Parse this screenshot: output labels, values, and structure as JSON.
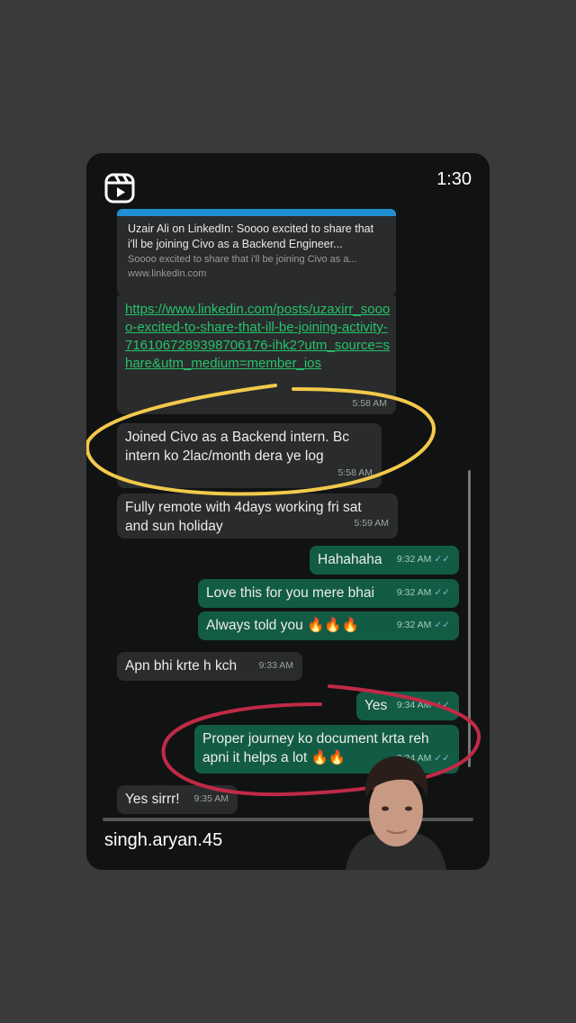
{
  "story": {
    "timer": "1:30",
    "username": "singh.aryan.45"
  },
  "link_preview": {
    "title": "Uzair Ali on LinkedIn: Soooo excited to share that i'll be joining Civo as a Backend Engineer...",
    "description": "Soooo excited to share that i'll be joining Civo as a...",
    "domain": "www.linkedin.com",
    "url": "https://www.linkedin.com/posts/uzaxirr_soooo-excited-to-share-that-ill-be-joining-activity-7161067289398706176-ihk2?utm_source=share&utm_medium=member_ios",
    "time": "5:58 AM"
  },
  "messages": [
    {
      "direction": "in",
      "text": "Joined Civo as a Backend intern. Bc intern ko 2lac/month dera ye log",
      "time": "5:58 AM"
    },
    {
      "direction": "in",
      "text": "Fully remote with 4days working fri sat and sun holiday",
      "time": "5:59 AM"
    },
    {
      "direction": "out",
      "text": "Hahahaha",
      "time": "9:32 AM"
    },
    {
      "direction": "out",
      "text": "Love this for you mere bhai",
      "time": "9:32 AM"
    },
    {
      "direction": "out",
      "text": "Always told you 🔥🔥🔥",
      "time": "9:32 AM"
    },
    {
      "direction": "in",
      "text": "Apn bhi krte h kch",
      "time": "9:33 AM"
    },
    {
      "direction": "out",
      "text": "Yes",
      "time": "9:34 AM"
    },
    {
      "direction": "out",
      "text": "Proper journey ko document krta reh apni it helps a lot 🔥🔥",
      "time": "9:34 AM"
    },
    {
      "direction": "in",
      "text": "Yes sirrr!",
      "time": "9:35 AM"
    }
  ],
  "icons": {
    "reels": "reels-icon",
    "read_receipt": "double-check-icon"
  },
  "colors": {
    "incoming": "#2a2b2c",
    "outgoing": "#125c45",
    "link": "#25c26a",
    "yellow_annotation": "#f2c94c",
    "red_annotation": "#c02a47"
  }
}
